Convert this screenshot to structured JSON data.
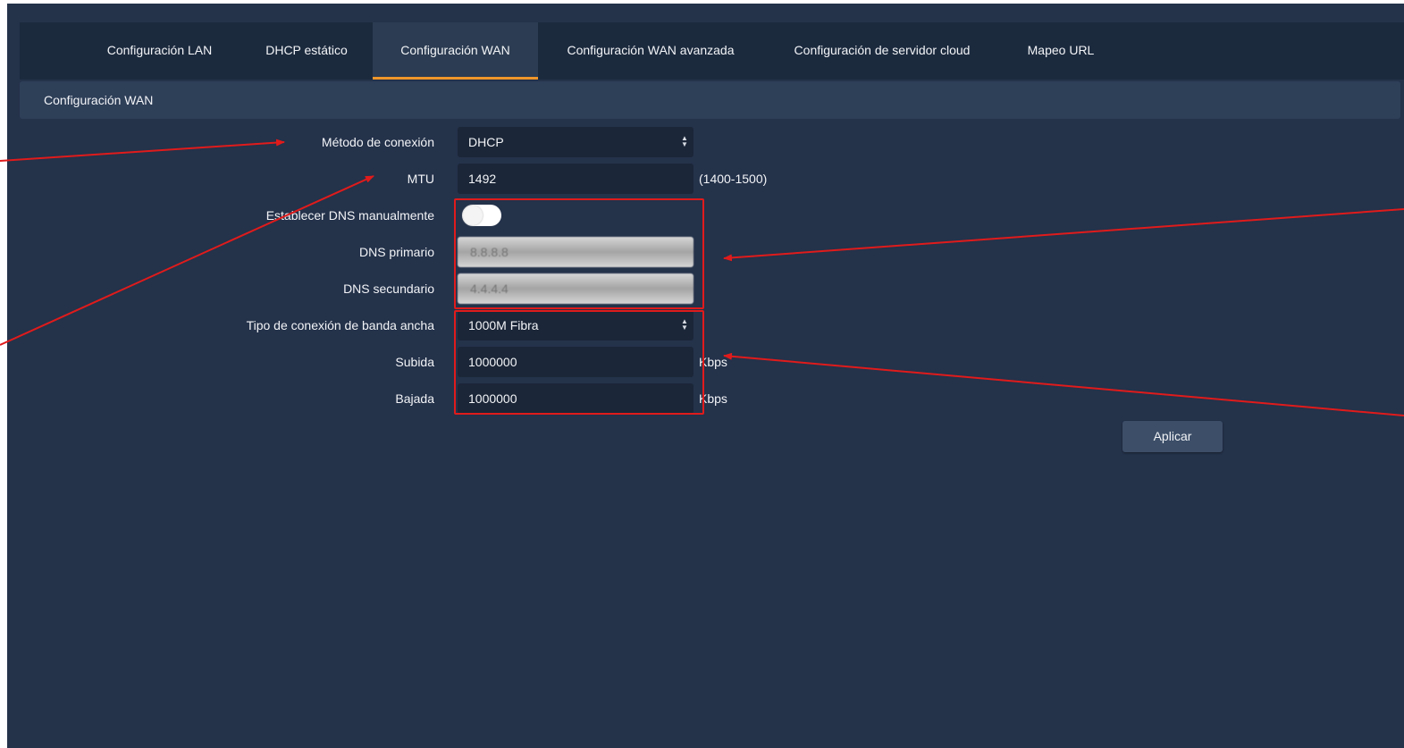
{
  "tabs": [
    {
      "label": "Configuración LAN",
      "active": false
    },
    {
      "label": "DHCP estático",
      "active": false
    },
    {
      "label": "Configuración WAN",
      "active": true
    },
    {
      "label": "Configuración WAN avanzada",
      "active": false
    },
    {
      "label": "Configuración de servidor cloud",
      "active": false
    },
    {
      "label": "Mapeo URL",
      "active": false
    }
  ],
  "section": {
    "title": "Configuración WAN"
  },
  "form": {
    "connection_method": {
      "label": "Método de conexión",
      "value": "DHCP"
    },
    "mtu": {
      "label": "MTU",
      "value": "1492",
      "range_hint": "(1400-1500)"
    },
    "manual_dns": {
      "label": "Establecer DNS manualmente",
      "enabled": false
    },
    "primary_dns": {
      "label": "DNS primario",
      "placeholder": "8.8.8.8"
    },
    "secondary_dns": {
      "label": "DNS secundario",
      "placeholder": "4.4.4.4"
    },
    "broadband_type": {
      "label": "Tipo de conexión de banda ancha",
      "value": "1000M Fibra"
    },
    "upload": {
      "label": "Subida",
      "value": "1000000",
      "unit": "Kbps"
    },
    "download": {
      "label": "Bajada",
      "value": "1000000",
      "unit": "Kbps"
    }
  },
  "buttons": {
    "apply": "Aplicar"
  },
  "colors": {
    "background": "#24324a",
    "tab_bar": "#1c2a3e",
    "active_tab_underline": "#f0962a",
    "annotation": "#e01b1b"
  }
}
